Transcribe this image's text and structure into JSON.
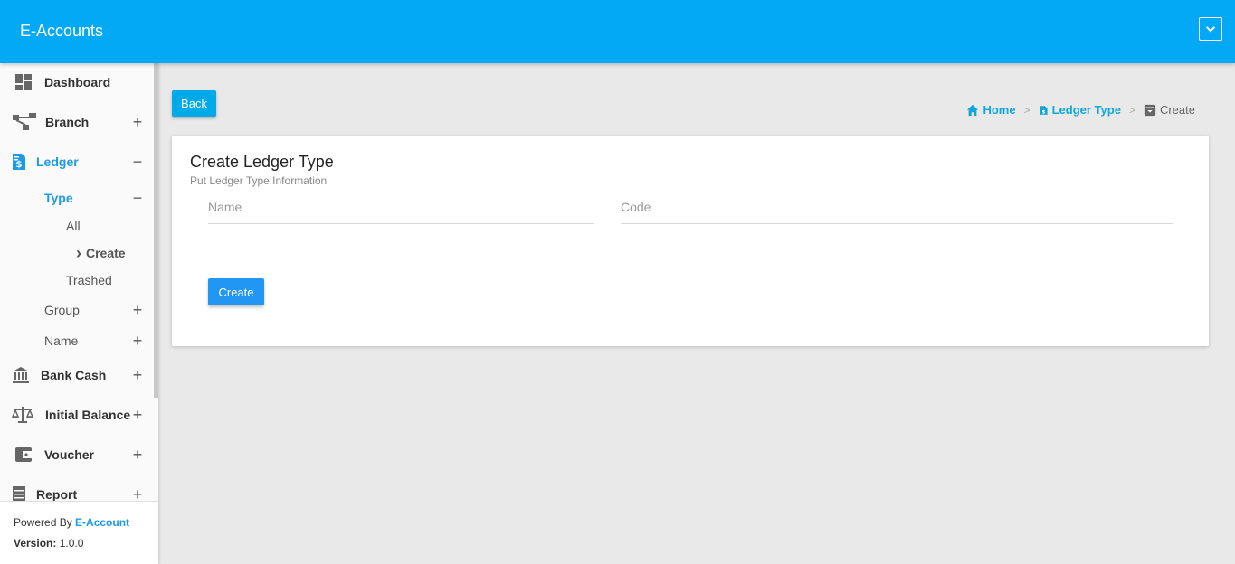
{
  "app": {
    "title": "E-Accounts"
  },
  "icons": {
    "dropdown": "chevron-down-icon",
    "dashboard": "dashboard-icon",
    "branch": "sitemap-icon",
    "ledger": "ledger-doc-icon",
    "bank_cash": "bank-icon",
    "initial_balance": "scale-balance-icon",
    "voucher": "wallet-icon",
    "report": "report-icon",
    "home": "home-icon",
    "ledger_type": "ledger-doc-icon",
    "create": "archive-icon"
  },
  "colors": {
    "topbar": "#03a9f4",
    "accent": "#1e9be6",
    "back_button": "#00a9e8",
    "create_button": "#2196f3"
  },
  "sidebar": {
    "items": [
      {
        "label": "Dashboard"
      },
      {
        "label": "Branch",
        "toggle": "+"
      },
      {
        "label": "Ledger",
        "toggle": "−"
      },
      {
        "label": "Bank Cash",
        "toggle": "+"
      },
      {
        "label": "Initial Balance",
        "toggle": "+"
      },
      {
        "label": "Voucher",
        "toggle": "+"
      },
      {
        "label": "Report",
        "toggle": "+"
      }
    ],
    "ledger_sub": [
      {
        "label": "Type",
        "toggle": "−"
      },
      {
        "label": "Group",
        "toggle": "+"
      },
      {
        "label": "Name",
        "toggle": "+"
      }
    ],
    "type_sub": [
      {
        "label": "All"
      },
      {
        "label": "Create",
        "marker": "›"
      },
      {
        "label": "Trashed"
      }
    ],
    "footer": {
      "powered_prefix": "Powered By",
      "powered_brand": "E-Account",
      "version_label": "Version:",
      "version_value": "1.0.0"
    }
  },
  "header": {
    "back_label": "Back"
  },
  "breadcrumb": [
    {
      "label": "Home"
    },
    {
      "label": "Ledger Type"
    },
    {
      "label": "Create"
    }
  ],
  "breadcrumb_sep": ">",
  "card": {
    "title": "Create Ledger Type",
    "subtitle": "Put Ledger Type Information",
    "fields": [
      {
        "placeholder": "Name",
        "value": ""
      },
      {
        "placeholder": "Code",
        "value": ""
      }
    ],
    "submit_label": "Create"
  }
}
